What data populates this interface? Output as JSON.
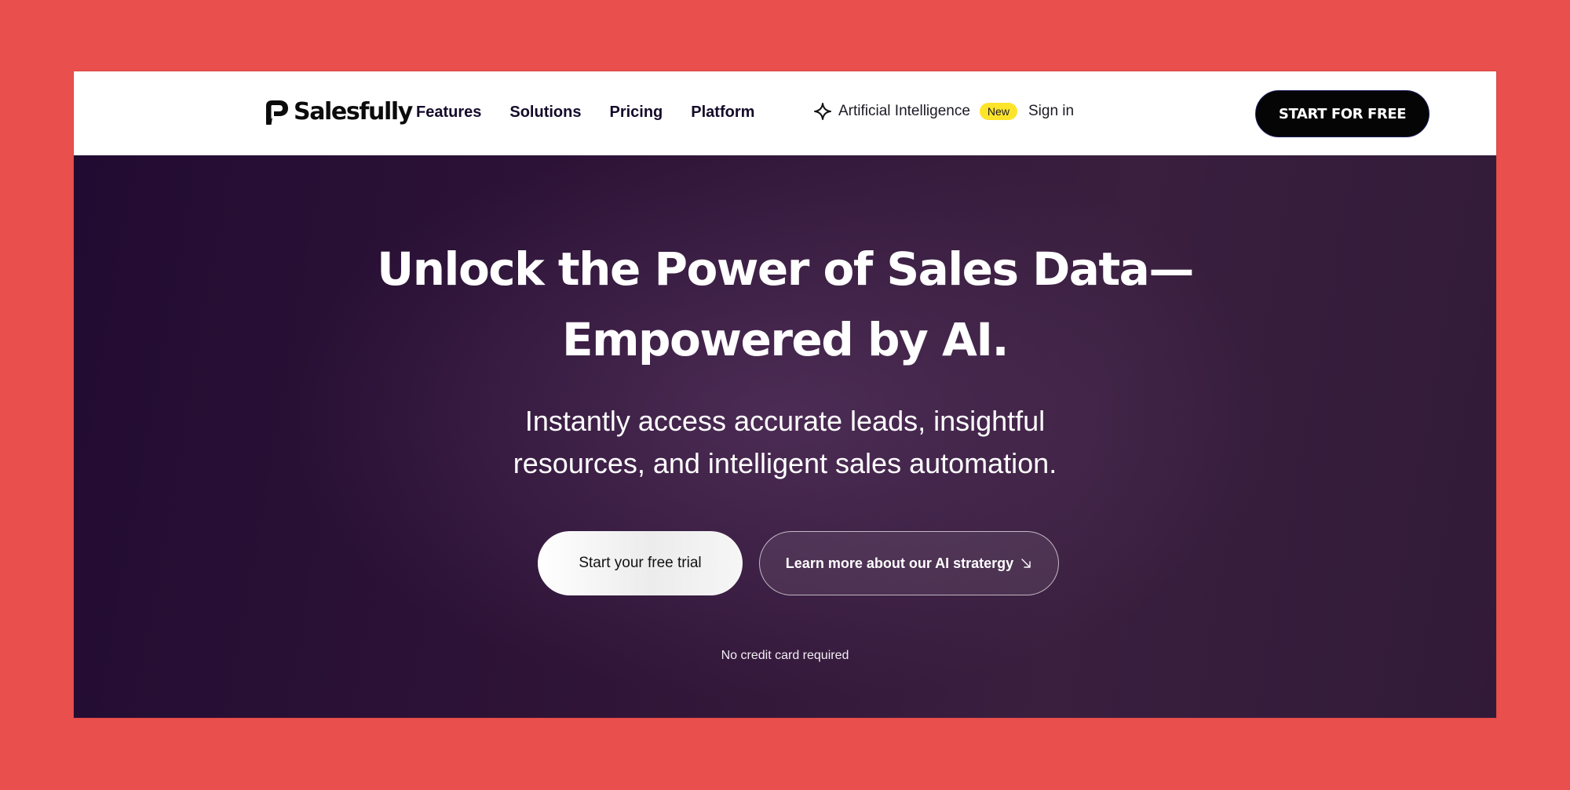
{
  "header": {
    "logo_text": "Salesfully",
    "nav": [
      {
        "label": "Features"
      },
      {
        "label": "Solutions"
      },
      {
        "label": "Pricing"
      },
      {
        "label": "Platform"
      }
    ],
    "ai_link": {
      "label": "Artificial Intelligence",
      "badge": "New",
      "icon": "sparkle-icon"
    },
    "sign_in": "Sign in",
    "cta": "START FOR FREE"
  },
  "hero": {
    "title_lines": [
      "Unlock the Power of Sales Data—",
      "Empowered by AI."
    ],
    "subtitle_lines": [
      "Instantly access accurate leads, insightful",
      "resources, and intelligent sales automation."
    ],
    "primary_button": "Start your free trial",
    "secondary_button": "Learn more about our AI stratergy",
    "secondary_icon": "arrow-down-right-icon",
    "note": "No credit card required"
  },
  "colors": {
    "page_background": "#e94f4c",
    "hero_background": "#2f1437",
    "badge": "#fce42b",
    "cta": "#050505"
  }
}
